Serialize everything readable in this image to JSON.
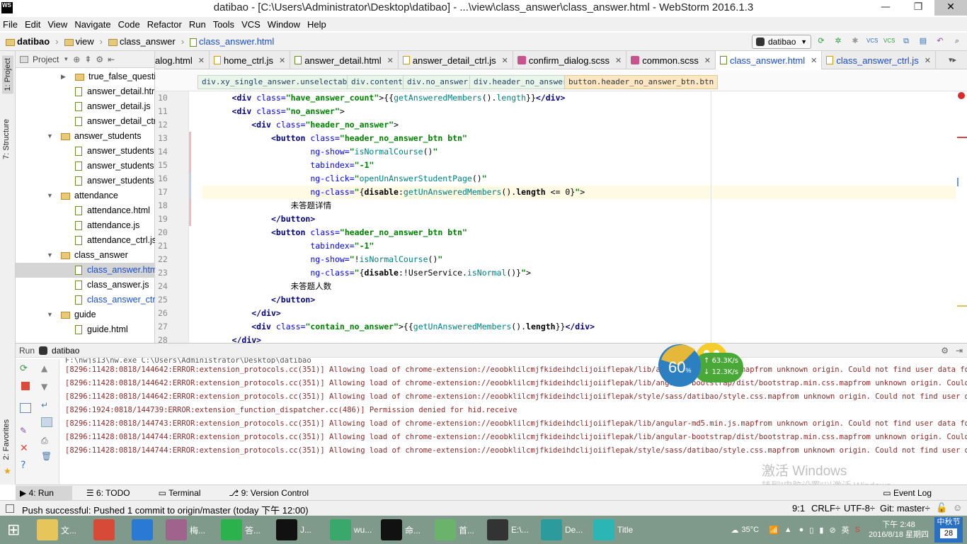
{
  "window": {
    "title": "datibao - [C:\\Users\\Administrator\\Desktop\\datibao] - ...\\view\\class_answer\\class_answer.html - WebStorm 2016.1.3",
    "app_badge": "WS",
    "min": "—",
    "max": "❐",
    "close": "✕"
  },
  "menu": [
    "File",
    "Edit",
    "View",
    "Navigate",
    "Code",
    "Refactor",
    "Run",
    "Tools",
    "VCS",
    "Window",
    "Help"
  ],
  "breadcrumb": {
    "items": [
      "datibao",
      "view",
      "class_answer",
      "class_answer.html"
    ],
    "run_config": "datibao"
  },
  "project_panel": {
    "title": "Project",
    "tree": [
      {
        "indent": 3,
        "type": "folder",
        "arrow": "▶",
        "label": "true_false_questi"
      },
      {
        "indent": 4,
        "type": "file",
        "label": "answer_detail.htr"
      },
      {
        "indent": 4,
        "type": "file",
        "label": "answer_detail.js"
      },
      {
        "indent": 4,
        "type": "file",
        "label": "answer_detail_ctr"
      },
      {
        "indent": 2,
        "type": "folder",
        "arrow": "▼",
        "label": "answer_students"
      },
      {
        "indent": 4,
        "type": "file",
        "label": "answer_students"
      },
      {
        "indent": 4,
        "type": "file",
        "label": "answer_students"
      },
      {
        "indent": 4,
        "type": "file",
        "label": "answer_students"
      },
      {
        "indent": 2,
        "type": "folder",
        "arrow": "▼",
        "label": "attendance"
      },
      {
        "indent": 4,
        "type": "file",
        "label": "attendance.html"
      },
      {
        "indent": 4,
        "type": "file",
        "label": "attendance.js"
      },
      {
        "indent": 4,
        "type": "file",
        "label": "attendance_ctrl.js"
      },
      {
        "indent": 2,
        "type": "folder",
        "arrow": "▼",
        "label": "class_answer"
      },
      {
        "indent": 4,
        "type": "file",
        "label": "class_answer.htm",
        "selected": true
      },
      {
        "indent": 4,
        "type": "file",
        "label": "class_answer.js"
      },
      {
        "indent": 4,
        "type": "file",
        "label": "class_answer_ctrl"
      },
      {
        "indent": 2,
        "type": "folder",
        "arrow": "▼",
        "label": "guide"
      },
      {
        "indent": 4,
        "type": "file",
        "label": "guide.html"
      }
    ]
  },
  "side_tabs": {
    "project": "1: Project",
    "structure": "7: Structure",
    "favorites": "2: Favorites"
  },
  "editor_tabs": [
    {
      "label": "alog.html",
      "icon": "html"
    },
    {
      "label": "home_ctrl.js",
      "icon": "js"
    },
    {
      "label": "answer_detail.html",
      "icon": "html"
    },
    {
      "label": "answer_detail_ctrl.js",
      "icon": "js"
    },
    {
      "label": "confirm_dialog.scss",
      "icon": "sass"
    },
    {
      "label": "common.scss",
      "icon": "sass"
    },
    {
      "label": "class_answer.html",
      "icon": "html",
      "active": true
    },
    {
      "label": "class_answer_ctrl.js",
      "icon": "js",
      "active_text": true
    }
  ],
  "tag_breadcrumb": [
    "div.xy_single_answer.unselectable",
    "div.content",
    "div.no_answer",
    "div.header_no_answer",
    "button.header_no_answer_btn.btn"
  ],
  "line_numbers": [
    "10",
    "11",
    "12",
    "13",
    "14",
    "15",
    "16",
    "17",
    "18",
    "19",
    "20",
    "21",
    "22",
    "23",
    "24",
    "25",
    "26",
    "27",
    "28"
  ],
  "code_lines": [
    {
      "indent": "      ",
      "html": "<span class=\"tg\">&lt;div</span> <span class=\"at\">class=</span><span class=\"st\">\"have_answer_count\"</span>&gt;{{<span class=\"ng\">getAnsweredMembers</span>().<span class=\"ng\">length</span>}}<span class=\"tg\">&lt;/div&gt;</span>"
    },
    {
      "indent": "      ",
      "html": "<span class=\"tg\">&lt;div</span> <span class=\"at\">class=</span><span class=\"st\">\"no_answer\"</span>&gt;"
    },
    {
      "indent": "          ",
      "html": "<span class=\"tg\">&lt;div</span> <span class=\"at\">class=</span><span class=\"st\">\"header_no_answer\"</span>&gt;"
    },
    {
      "indent": "              ",
      "html": "<span class=\"tg\">&lt;button</span> <span class=\"at\">class=</span><span class=\"st\">\"header_no_answer_btn btn\"</span>"
    },
    {
      "indent": "                      ",
      "html": "<span class=\"at\">ng-show=</span><span class=\"st\">\"</span><span class=\"ng\">isNormalCourse</span>()<span class=\"st\">\"</span>"
    },
    {
      "indent": "                      ",
      "html": "<span class=\"at\">tabindex=</span><span class=\"st\">\"-1\"</span>"
    },
    {
      "indent": "                      ",
      "html": "<span class=\"at\">ng-click=</span><span class=\"st\">\"</span><span class=\"ng\">openUnAnswerStudentPage</span>()<span class=\"st\">\"</span>"
    },
    {
      "indent": "                      ",
      "html": "<span class=\"at\">ng-class=</span><span class=\"st\">\"</span>{<b>disable</b>:<span class=\"ng\">getUnAnsweredMembers</span>().<b>length</b> &lt;= 0}<span class=\"st\">\"</span>&gt;",
      "current": true
    },
    {
      "indent": "                  ",
      "html": "未答题详情"
    },
    {
      "indent": "              ",
      "html": "<span class=\"tg\">&lt;/button&gt;</span>"
    },
    {
      "indent": "              ",
      "html": "<span class=\"tg\">&lt;button</span> <span class=\"at\">class=</span><span class=\"st\">\"header_no_answer_btn btn\"</span>"
    },
    {
      "indent": "                      ",
      "html": "<span class=\"at\">tabindex=</span><span class=\"st\">\"-1\"</span>"
    },
    {
      "indent": "                      ",
      "html": "<span class=\"at\">ng-show=</span><span class=\"st\">\"</span>!<span class=\"ng\">isNormalCourse</span>()<span class=\"st\">\"</span>"
    },
    {
      "indent": "                      ",
      "html": "<span class=\"at\">ng-class=</span><span class=\"st\">\"</span>{<b>disable</b>:!UserService.<span class=\"ng\">isNormal</span>()}<span class=\"st\">\"</span>&gt;"
    },
    {
      "indent": "                  ",
      "html": "未答题人数"
    },
    {
      "indent": "              ",
      "html": "<span class=\"tg\">&lt;/button&gt;</span>"
    },
    {
      "indent": "          ",
      "html": "<span class=\"tg\">&lt;/div&gt;</span>"
    },
    {
      "indent": "          ",
      "html": "<span class=\"tg\">&lt;div</span> <span class=\"at\">class=</span><span class=\"st\">\"contain_no_answer\"</span>&gt;{{<span class=\"ng\">getUnAnsweredMembers</span>().<b>length</b>}}<span class=\"tg\">&lt;/div&gt;</span>"
    },
    {
      "indent": "      ",
      "html": "<span class=\"tg\">&lt;/div&gt;</span>"
    }
  ],
  "run_panel": {
    "label": "Run",
    "config": "datibao",
    "console_first": "F:\\nwjs13\\nw.exe C:\\Users\\Administrator\\Desktop\\datibao",
    "console": [
      "[8296:11428:0818/144642:ERROR:extension_protocols.cc(351)] Allowing load of chrome-extension://eoobklilcmjfkideihdclijoiiflepak/lib/angular-md5.min.js.mapfrom unknown origin. Could not find user data for request.",
      "[8296:11428:0818/144642:ERROR:extension_protocols.cc(351)] Allowing load of chrome-extension://eoobklilcmjfkideihdclijoiiflepak/lib/angular-bootstrap/dist/bootstrap.min.css.mapfrom unknown origin. Could not find",
      "[8296:11428:0818/144642:ERROR:extension_protocols.cc(351)] Allowing load of chrome-extension://eoobklilcmjfkideihdclijoiiflepak/style/sass/datibao/style.css.mapfrom unknown origin. Could not find user data for re",
      "[8296:1924:0818/144739:ERROR:extension_function_dispatcher.cc(486)] Permission denied for hid.receive",
      "[8296:11428:0818/144743:ERROR:extension_protocols.cc(351)] Allowing load of chrome-extension://eoobklilcmjfkideihdclijoiiflepak/lib/angular-md5.min.js.mapfrom unknown origin. Could not find user data for request.",
      "[8296:11428:0818/144744:ERROR:extension_protocols.cc(351)] Allowing load of chrome-extension://eoobklilcmjfkideihdclijoiiflepak/lib/angular-bootstrap/dist/bootstrap.min.css.mapfrom unknown origin. Could not find",
      "[8296:11428:0818/144744:ERROR:extension_protocols.cc(351)] Allowing load of chrome-extension://eoobklilcmjfkideihdclijoiiflepak/style/sass/datibao/style.css.mapfrom unknown origin. Could not find user data for re"
    ]
  },
  "net_widget": {
    "percent": "60",
    "percent_sign": "%",
    "up": "63.3K/s",
    "down": "12.3K/s"
  },
  "watermark": {
    "line1": "激活 Windows",
    "line2": "转到\"电脑设置\"以激活 Windows。"
  },
  "tool_windows": {
    "run": "4: Run",
    "todo": "6: TODO",
    "terminal": "Terminal",
    "vcs": "9: Version Control",
    "event_log": "Event Log"
  },
  "status": {
    "message": "Push successful: Pushed 1 commit to origin/master (today 下午 12:00)",
    "position": "9:1",
    "line_sep": "CRLF÷",
    "encoding": "UTF-8÷",
    "git": "Git: master÷"
  },
  "taskbar": {
    "items": [
      {
        "label": "文...",
        "color": "#e6c55a"
      },
      {
        "label": "",
        "color": "#d84a38"
      },
      {
        "label": "",
        "color": "#2a7ad5"
      },
      {
        "label": "梅...",
        "color": "#a0648c"
      },
      {
        "label": "答...",
        "color": "#2bb24c"
      },
      {
        "label": "J...",
        "color": "#111111"
      },
      {
        "label": "wu...",
        "color": "#3aa86b"
      },
      {
        "label": "命...",
        "color": "#111111"
      },
      {
        "label": "首...",
        "color": "#6bb36b"
      },
      {
        "label": "E:\\...",
        "color": "#333333"
      },
      {
        "label": "De...",
        "color": "#2c9b9b"
      },
      {
        "label": "Title",
        "color": "#2cb5b5"
      }
    ],
    "weather": "35°C",
    "time": "下午 2:48",
    "date": "2016/8/18 星期四",
    "festival": "中秋节",
    "festival_day": "28"
  }
}
